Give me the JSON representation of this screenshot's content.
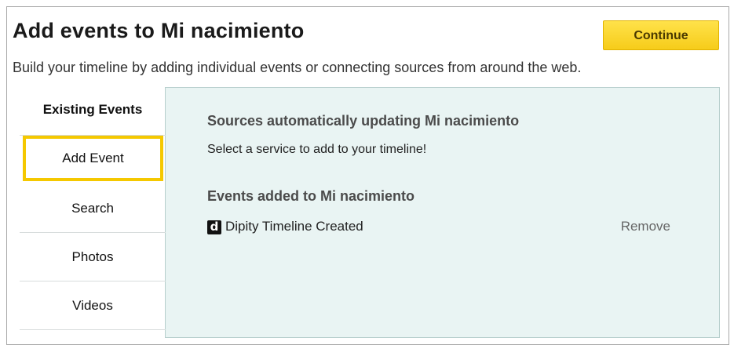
{
  "header": {
    "title": "Add events to Mi nacimiento",
    "subtitle": "Build your timeline by adding individual events or connecting sources from around the web.",
    "continue_label": "Continue"
  },
  "sidebar": {
    "items": [
      {
        "label": "Existing Events",
        "state": "active"
      },
      {
        "label": "Add Event",
        "state": "highlighted"
      },
      {
        "label": "Search",
        "state": "normal"
      },
      {
        "label": "Photos",
        "state": "normal"
      },
      {
        "label": "Videos",
        "state": "normal"
      }
    ]
  },
  "content": {
    "sources_title": "Sources automatically updating Mi nacimiento",
    "sources_text": "Select a service to add to your timeline!",
    "events_title": "Events added to Mi nacimiento",
    "events": [
      {
        "icon": "dipity-logo-icon",
        "icon_glyph": "d",
        "label": "Dipity Timeline Created",
        "action": "Remove"
      }
    ]
  },
  "colors": {
    "accent": "#f5c800",
    "panel_bg": "#e9f4f3",
    "button_bg": "#ffe24a"
  }
}
